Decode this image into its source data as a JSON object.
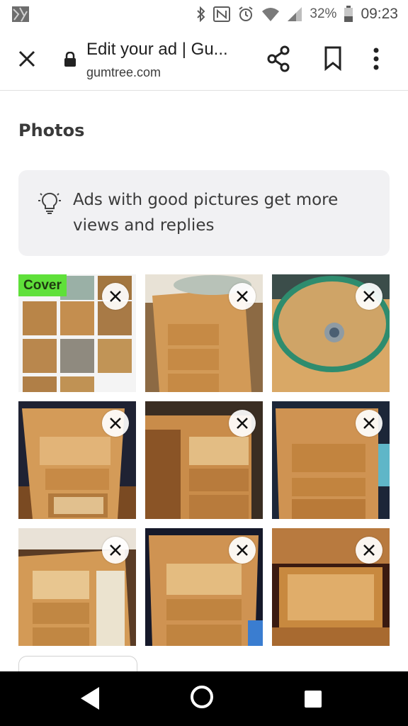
{
  "status_bar": {
    "battery_percent": "32%",
    "time": "09:23",
    "icons": [
      "app-notification-icon",
      "bluetooth-icon",
      "nfc-icon",
      "alarm-icon",
      "wifi-icon",
      "signal-icon",
      "battery-icon"
    ]
  },
  "toolbar": {
    "title": "Edit your ad | Gu...",
    "url": "gumtree.com",
    "icons": [
      "close-icon",
      "lock-icon",
      "share-icon",
      "bookmark-icon",
      "more-vert-icon"
    ]
  },
  "photos_section": {
    "title": "Photos",
    "tip": "Ads with good pictures get more views and replies",
    "cover_label": "Cover",
    "photos": [
      {
        "index": 1,
        "is_cover": true
      },
      {
        "index": 2
      },
      {
        "index": 3
      },
      {
        "index": 4
      },
      {
        "index": 5
      },
      {
        "index": 6
      },
      {
        "index": 7
      },
      {
        "index": 8
      },
      {
        "index": 9
      }
    ]
  },
  "colors": {
    "cover_badge": "#5fe03a",
    "wood": "#c89a5e",
    "tip_background": "#f1f1f3",
    "nav_background": "#000000"
  },
  "nav_bar": {
    "icons": [
      "back-icon",
      "home-icon",
      "recents-icon"
    ]
  }
}
